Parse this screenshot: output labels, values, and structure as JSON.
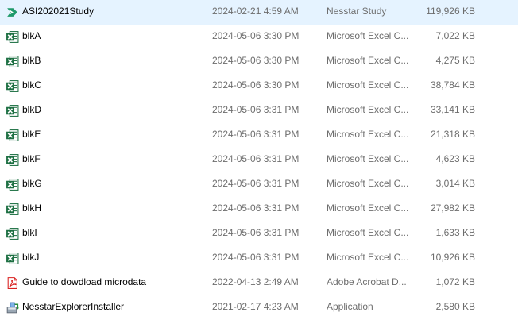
{
  "colors": {
    "background": "#ffffff",
    "name_text": "#000000",
    "meta_text": "#6d6d6d",
    "excel_green": "#1d6f42",
    "pdf_red": "#d9201f",
    "nesstar_green": "#1e9a6a"
  },
  "files": [
    {
      "name": "ASI202021Study",
      "date": "2024-02-21 4:59 AM",
      "type": "Nesstar Study",
      "size": "119,926 KB",
      "icon": "nesstar-study-icon"
    },
    {
      "name": "blkA",
      "date": "2024-05-06 3:30 PM",
      "type": "Microsoft Excel C...",
      "size": "7,022 KB",
      "icon": "excel-csv-icon"
    },
    {
      "name": "blkB",
      "date": "2024-05-06 3:30 PM",
      "type": "Microsoft Excel C...",
      "size": "4,275 KB",
      "icon": "excel-csv-icon"
    },
    {
      "name": "blkC",
      "date": "2024-05-06 3:30 PM",
      "type": "Microsoft Excel C...",
      "size": "38,784 KB",
      "icon": "excel-csv-icon"
    },
    {
      "name": "blkD",
      "date": "2024-05-06 3:31 PM",
      "type": "Microsoft Excel C...",
      "size": "33,141 KB",
      "icon": "excel-csv-icon"
    },
    {
      "name": "blkE",
      "date": "2024-05-06 3:31 PM",
      "type": "Microsoft Excel C...",
      "size": "21,318 KB",
      "icon": "excel-csv-icon"
    },
    {
      "name": "blkF",
      "date": "2024-05-06 3:31 PM",
      "type": "Microsoft Excel C...",
      "size": "4,623 KB",
      "icon": "excel-csv-icon"
    },
    {
      "name": "blkG",
      "date": "2024-05-06 3:31 PM",
      "type": "Microsoft Excel C...",
      "size": "3,014 KB",
      "icon": "excel-csv-icon"
    },
    {
      "name": "blkH",
      "date": "2024-05-06 3:31 PM",
      "type": "Microsoft Excel C...",
      "size": "27,982 KB",
      "icon": "excel-csv-icon"
    },
    {
      "name": "blkI",
      "date": "2024-05-06 3:31 PM",
      "type": "Microsoft Excel C...",
      "size": "1,633 KB",
      "icon": "excel-csv-icon"
    },
    {
      "name": "blkJ",
      "date": "2024-05-06 3:31 PM",
      "type": "Microsoft Excel C...",
      "size": "10,926 KB",
      "icon": "excel-csv-icon"
    },
    {
      "name": "Guide to dowdload microdata",
      "date": "2022-04-13 2:49 AM",
      "type": "Adobe Acrobat D...",
      "size": "1,072 KB",
      "icon": "pdf-icon"
    },
    {
      "name": "NesstarExplorerInstaller",
      "date": "2021-02-17 4:23 AM",
      "type": "Application",
      "size": "2,580 KB",
      "icon": "installer-icon"
    }
  ]
}
